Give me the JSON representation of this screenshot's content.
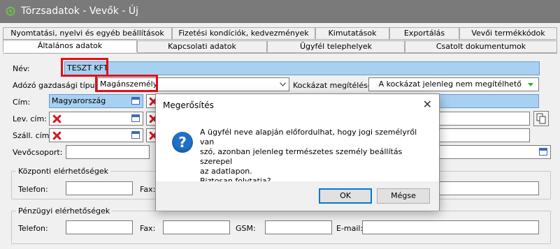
{
  "window": {
    "title": "Törzsadatok - Vevők - Új"
  },
  "tabs_top": [
    "Nyomtatási, nyelvi és egyéb beállítások",
    "Fizetési kondíciók, kedvezmények",
    "Kimutatások",
    "Exportálás",
    "Vevői termékkódok"
  ],
  "tabs_bottom": [
    "Általános adatok",
    "Kapcsolati adatok",
    "Ügyfél telephelyek",
    "Csatolt dokumentumok"
  ],
  "form": {
    "name_label": "Név:",
    "name_value": "TESZT KFT",
    "tax_type_label": "Adózó gazdasági típusa:",
    "tax_type_value": "Magánszemély",
    "risk_label": "Kockázat megítélése:",
    "risk_value": "A kockázat jelenleg nem megítélhető",
    "address_label": "Cím:",
    "address_country": "Magyarország",
    "mail_address_label": "Lev. cím:",
    "ship_address_label": "Száll. cím:",
    "customer_group_label": "Vevőcsoport:"
  },
  "central_contact": {
    "title": "Központi elérhetőségek",
    "phone_label": "Telefon:",
    "fax_label": "Fax:"
  },
  "financial_contact": {
    "title": "Pénzügyi elérhetőségek",
    "phone_label": "Telefon:",
    "fax_label": "Fax:",
    "gsm_label": "GSM:",
    "email_label": "E-mail:"
  },
  "dialog": {
    "title": "Megerősítés",
    "message_lines": [
      "A ügyfél neve alapján előfordulhat, hogy jogi személyről van",
      "szó, azonban jelenleg természetes személy beállítás szerepel",
      "az adatlapon.",
      "Biztosan folytatja?"
    ],
    "ok_label": "OK",
    "cancel_label": "Mégse",
    "icon": "question-icon"
  },
  "colors": {
    "highlight": "#e0101a",
    "selection": "#a8d0f0",
    "accent": "#0078d7"
  }
}
